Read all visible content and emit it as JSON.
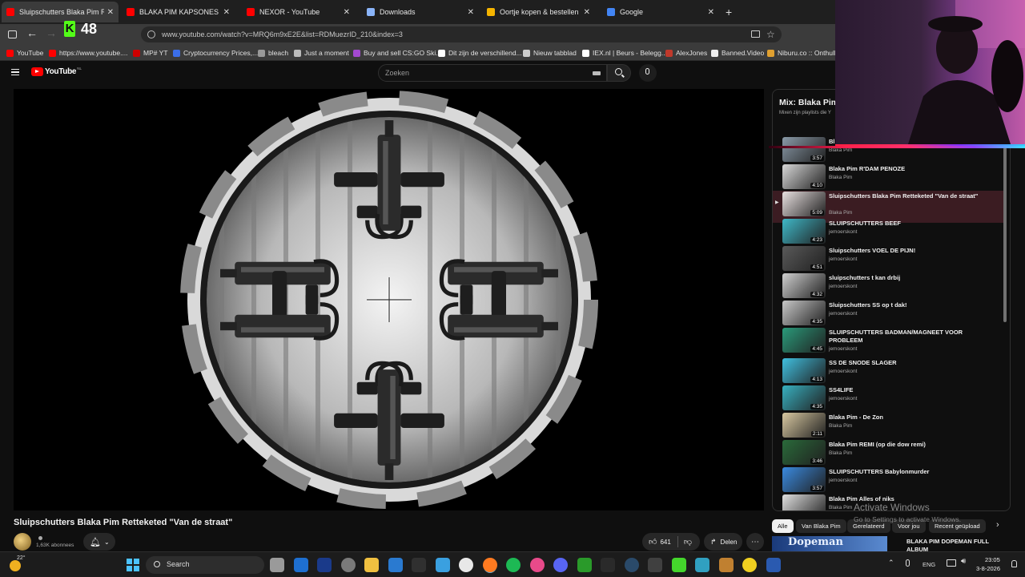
{
  "browser": {
    "tabs": [
      {
        "title": "Sluipschutters Blaka Pim Retteke",
        "active": true,
        "favicon_color": "#ff0000"
      },
      {
        "title": "BLAKA PIM KAPSONES - Yo",
        "active": false,
        "favicon_color": "#ff0000"
      },
      {
        "title": "NEXOR - YouTube",
        "active": false,
        "favicon_color": "#ff0000"
      },
      {
        "title": "Downloads",
        "active": false,
        "favicon_color": "#8ab4f8"
      },
      {
        "title": "Oortje kopen & bestellen | Jum",
        "active": false,
        "favicon_color": "#f5b400"
      },
      {
        "title": "Google",
        "active": false,
        "favicon_color": "#4285f4"
      }
    ],
    "new_tab_label": "+",
    "url": "www.youtube.com/watch?v=MRQ6m9xE2E&list=RDMuezrID_210&index=3",
    "kick_count": "48",
    "bookmarks": [
      {
        "label": "YouTube",
        "color": "#ff0000"
      },
      {
        "label": "https://www.youtube....",
        "color": "#ff0000"
      },
      {
        "label": "MP# YT",
        "color": "#cc0000"
      },
      {
        "label": "Cryptocurrency Prices,...",
        "color": "#3b6ee8"
      },
      {
        "label": "bleach",
        "color": "#999999"
      },
      {
        "label": "Just a moment",
        "color": "#bbbbbb"
      },
      {
        "label": "Buy and sell CS:GO Ski...",
        "color": "#a349d1"
      },
      {
        "label": "Dit zijn de verschillend...",
        "color": "#ffffff"
      },
      {
        "label": "Nieuw tabblad",
        "color": "#cccccc"
      },
      {
        "label": "IEX.nl | Beurs - Belegg...",
        "color": "#ffffff"
      },
      {
        "label": "AlexJones",
        "color": "#c0392b"
      },
      {
        "label": "Banned.Video",
        "color": "#eeeeee"
      },
      {
        "label": "Niburu.co :: Onthulle",
        "color": "#e0a030"
      }
    ]
  },
  "youtube": {
    "logo": "YouTube",
    "logo_country": "NL",
    "search_placeholder": "Zoeken",
    "video_title": "Sluipschutters Blaka Pim Retteketed \"Van de straat\"",
    "channel_subscribers": "1,63K abonnees",
    "likes": "641",
    "share_label": "Delen",
    "mix_title": "Mix: Blaka Pim",
    "mix_subtitle": "Mixen zijn playlists die Y",
    "playlist": [
      {
        "title": "Bl",
        "channel": "Blaka Pim",
        "duration": "3:57",
        "thumb": "#8a9aa8",
        "active": false
      },
      {
        "title": "Blaka Pim R'DAM PENOZE",
        "channel": "Blaka Pim",
        "duration": "4:10",
        "thumb": "#d8d8d8",
        "active": false
      },
      {
        "title": "Sluipschutters Blaka Pim Retteketed \"Van de straat\"",
        "channel": "Blaka Pim",
        "duration": "5:09",
        "thumb": "#e8e0e0",
        "active": true
      },
      {
        "title": "SLUIPSCHUTTERS BEEF",
        "channel": "jemoerskont",
        "duration": "4:23",
        "thumb": "#3fb8c8",
        "active": false
      },
      {
        "title": "Sluipschutters VOEL DE PIJN!",
        "channel": "jemoerskont",
        "duration": "4:51",
        "thumb": "#5a5a5a",
        "active": false
      },
      {
        "title": "sluipschutters t kan drbij",
        "channel": "jemoerskont",
        "duration": "4:32",
        "thumb": "#d0d0d0",
        "active": false
      },
      {
        "title": "Sluipschutters SS op t dak!",
        "channel": "jemoerskont",
        "duration": "4:35",
        "thumb": "#c8c8c8",
        "active": false
      },
      {
        "title": "SLUIPSCHUTTERS BADMAN/MAGNEET VOOR PROBLEEM",
        "channel": "jemoerskont",
        "duration": "4:45",
        "thumb": "#2a9a7a",
        "active": false
      },
      {
        "title": "SS DE SNODE SLAGER",
        "channel": "jemoerskont",
        "duration": "4:13",
        "thumb": "#40c0e0",
        "active": false
      },
      {
        "title": "SS4LIFE",
        "channel": "jemoerskont",
        "duration": "4:35",
        "thumb": "#38b0c0",
        "active": false
      },
      {
        "title": "Blaka Pim - De Zon",
        "channel": "Blaka Pim",
        "duration": "2:11",
        "thumb": "#d8c8a0",
        "active": false
      },
      {
        "title": "Blaka Pim REMI (op die dow remi)",
        "channel": "Blaka Pim",
        "duration": "3:46",
        "thumb": "#2a6a3a",
        "active": false
      },
      {
        "title": "SLUIPSCHUTTERS Babylonmurder",
        "channel": "jemoerskont",
        "duration": "3:57",
        "thumb": "#3a8ae0",
        "active": false
      },
      {
        "title": "Blaka Pim Alles of niks",
        "channel": "Blaka Pim",
        "duration": "",
        "thumb": "#e0e0e0",
        "active": false
      }
    ],
    "chips": [
      "Alle",
      "Van Blaka Pim",
      "Gerelateerd",
      "Voor jou",
      "Recent geüpload"
    ],
    "next_video_title": "BLAKA PIM DOPEMAN FULL ALBUM",
    "next_video_thumb_text": "Dopeman"
  },
  "windows": {
    "watermark_title": "Activate Windows",
    "watermark_sub": "Go to Settings to activate Windows.",
    "weather_temp": "22°",
    "search_placeholder": "Search",
    "language": "ENG",
    "time": "23:05",
    "date": "3-8-2026",
    "taskbar_apps": [
      {
        "name": "task-view",
        "color": "#9a9a9a"
      },
      {
        "name": "outlook",
        "color": "#1e6fd0"
      },
      {
        "name": "sbs",
        "color": "#1a3a8a"
      },
      {
        "name": "settings",
        "color": "#7a7a7a"
      },
      {
        "name": "explorer",
        "color": "#f0c040"
      },
      {
        "name": "virtualbox",
        "color": "#2a7ad0"
      },
      {
        "name": "terminal",
        "color": "#303030"
      },
      {
        "name": "photos",
        "color": "#3aa0e0"
      },
      {
        "name": "chrome",
        "color": "#e8e8e8"
      },
      {
        "name": "firefox",
        "color": "#ff7a20"
      },
      {
        "name": "spotify",
        "color": "#1db954"
      },
      {
        "name": "itunes",
        "color": "#e84a8a"
      },
      {
        "name": "discord",
        "color": "#5865f2"
      },
      {
        "name": "xbox",
        "color": "#2a9a2a"
      },
      {
        "name": "epic-games",
        "color": "#2a2a2a"
      },
      {
        "name": "steam",
        "color": "#2a4a6a"
      },
      {
        "name": "steam-link",
        "color": "#404040"
      },
      {
        "name": "razer",
        "color": "#44d62c"
      },
      {
        "name": "network-app",
        "color": "#30a0c0"
      },
      {
        "name": "game",
        "color": "#c08030"
      },
      {
        "name": "norton",
        "color": "#f0d020"
      },
      {
        "name": "pen-app",
        "color": "#2a5ab0"
      }
    ]
  },
  "colors": {
    "youtube_red": "#ff0000",
    "active_row": "#3b1c22",
    "kick_green": "#53fc18"
  }
}
